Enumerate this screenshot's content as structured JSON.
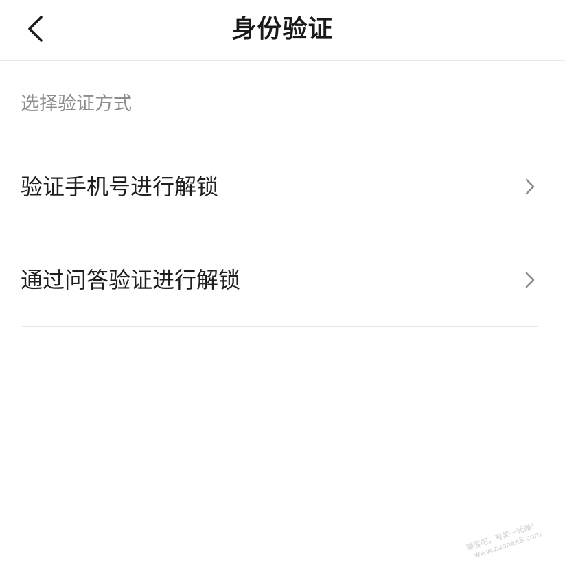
{
  "header": {
    "title": "身份验证",
    "back_icon": "chevron-left-icon"
  },
  "section": {
    "caption": "选择验证方式"
  },
  "options": [
    {
      "label": "验证手机号进行解锁",
      "icon": "chevron-right-icon"
    },
    {
      "label": "通过问答验证进行解锁",
      "icon": "chevron-right-icon"
    }
  ],
  "watermark": {
    "line1": "赚客吧，有奖一起赚！",
    "line2": "www.zuanke8.com"
  },
  "colors": {
    "title": "#1a1a1a",
    "caption": "#8c8c8c",
    "label": "#1f1f1f",
    "divider": "#e6e6e6",
    "chevron": "#8a8a8a",
    "background": "#ffffff"
  }
}
